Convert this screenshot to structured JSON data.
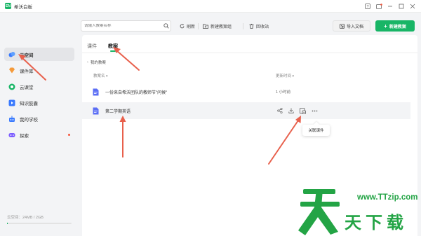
{
  "app": {
    "title": "希沃白板",
    "logo_text": "EN"
  },
  "sidebar": {
    "items": [
      {
        "label": "云空间",
        "icon": "cloud-icon",
        "color": "#3a7afe",
        "active": true
      },
      {
        "label": "课件库",
        "icon": "diamond-icon",
        "color": "#f59a3a",
        "active": false
      },
      {
        "label": "云课堂",
        "icon": "class-icon",
        "color": "#18b566",
        "active": false
      },
      {
        "label": "知识胶囊",
        "icon": "capsule-icon",
        "color": "#3a7afe",
        "active": false
      },
      {
        "label": "我的学校",
        "icon": "robot-icon",
        "color": "#3a7afe",
        "active": false
      },
      {
        "label": "探索",
        "icon": "gamepad-icon",
        "color": "#7b5cff",
        "active": false,
        "dot": true
      }
    ],
    "storage_text": "云空间：24MB / 2GB",
    "storage_used_fraction": 0.012
  },
  "toolbar": {
    "search_placeholder": "请输入教案名称",
    "refresh_label": "刷新",
    "new_folder_label": "新建教案组",
    "recycle_label": "回收站",
    "import_label": "导入文档",
    "new_label": "新建教案"
  },
  "tabs": [
    {
      "label": "课件",
      "active": false
    },
    {
      "label": "教案",
      "active": true
    }
  ],
  "breadcrumb": "我的教案",
  "columns": {
    "name": "教案名",
    "time": "更新时间"
  },
  "rows": [
    {
      "name": "一份来自希沃团队的教师节\"问候\"",
      "time": "1 小时前"
    },
    {
      "name": "第二学期英语",
      "time": ""
    }
  ],
  "tooltip": "关联课件",
  "colors": {
    "accent": "#18b566",
    "arrow": "#e8604c",
    "watermark": "#23a445"
  },
  "watermark": {
    "url": "www.TTzip.com",
    "text": "天下载"
  }
}
